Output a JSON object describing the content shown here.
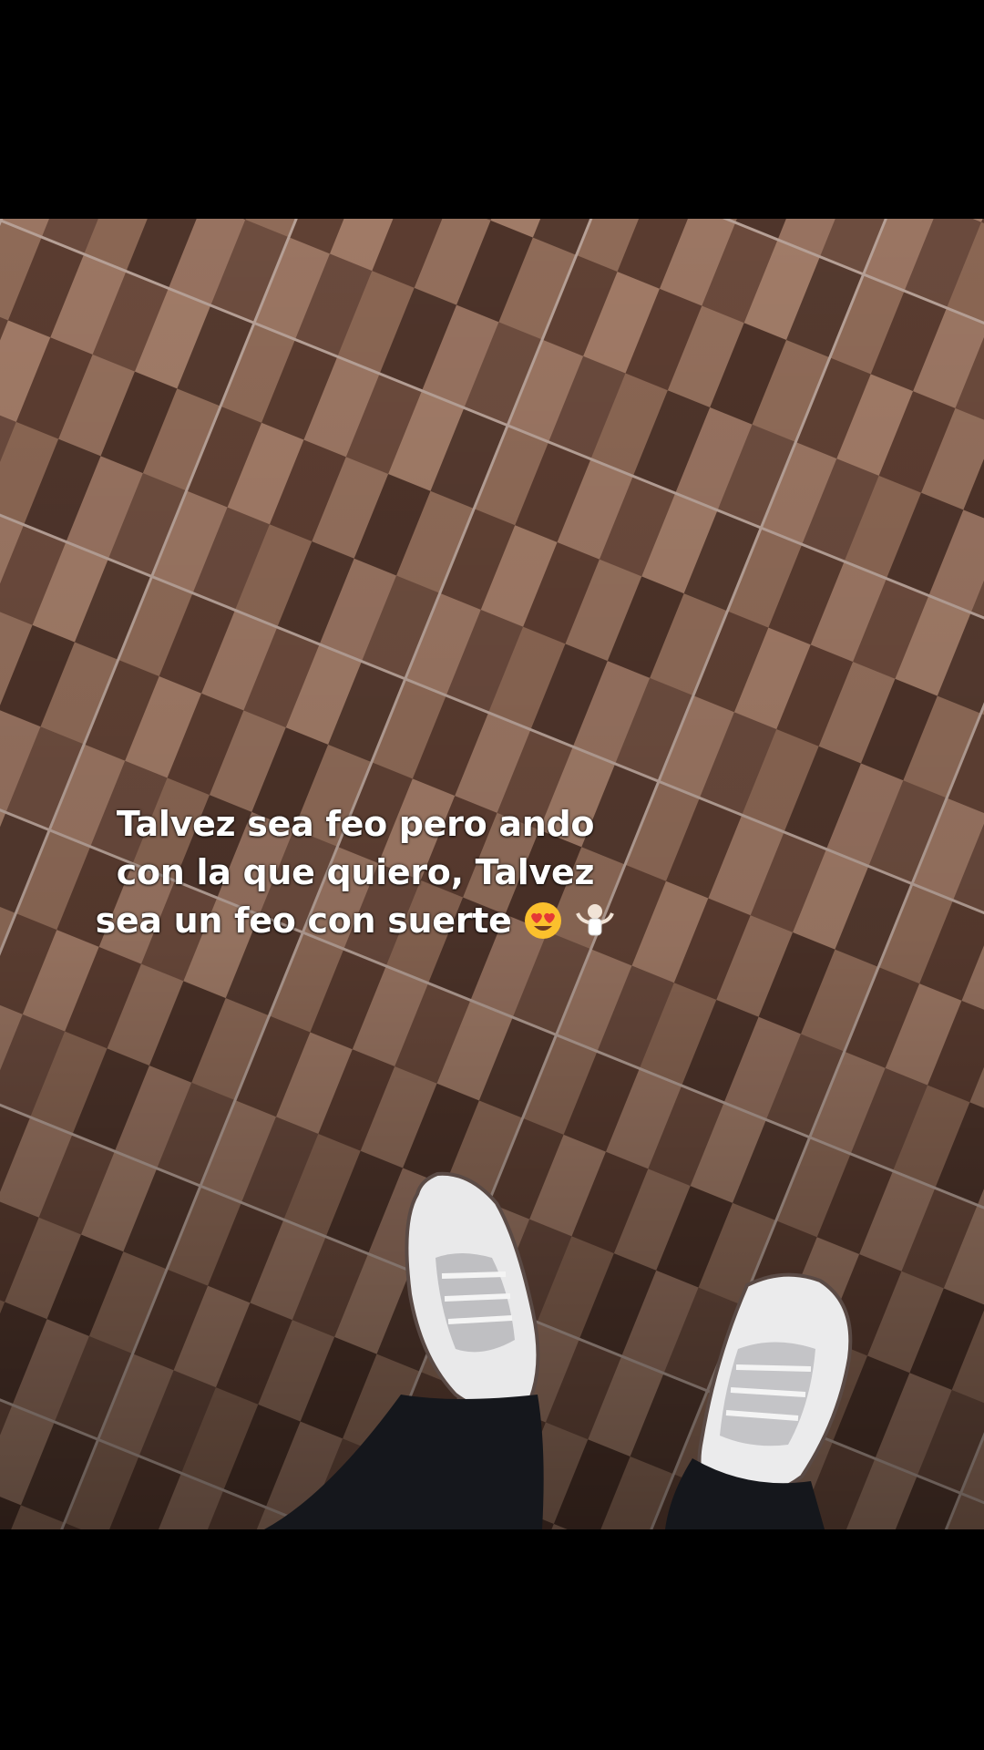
{
  "caption": {
    "line1": "Talvez sea feo pero ando",
    "line2": "con la que quiero, Talvez",
    "line3": "sea un feo con suerte",
    "emojis": [
      "heart-eyes-emoji",
      "shrug-emoji"
    ]
  },
  "colors": {
    "letterbox": "#000000",
    "tile_light": "#9a7461",
    "tile_mid": "#7a5747",
    "tile_dark": "#4e3229",
    "grout": "#b9a39a",
    "caption_text": "#ffffff"
  }
}
